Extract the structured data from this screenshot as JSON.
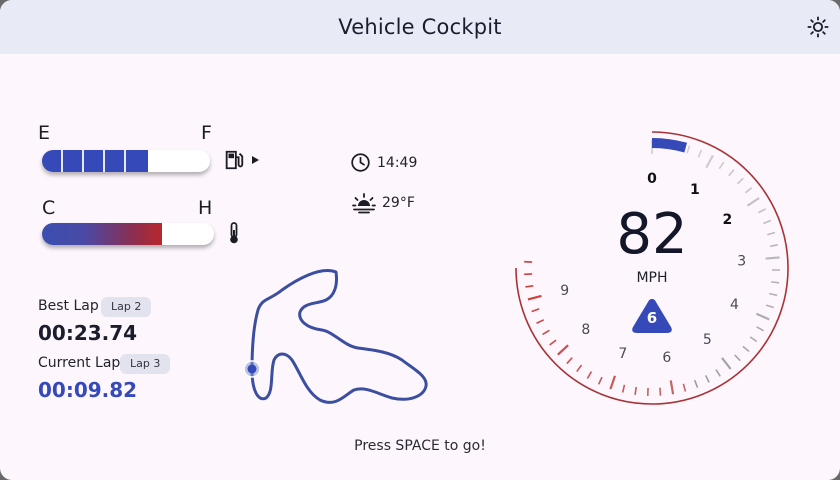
{
  "app": {
    "title": "Vehicle Cockpit",
    "theme_icon": "sun-icon"
  },
  "fuel": {
    "empty_label": "E",
    "full_label": "F",
    "level": 0.63,
    "segments_filled": 5,
    "icon": "fuel-pump-icon",
    "indicator_icon": "play-arrow-icon"
  },
  "temperature": {
    "cold_label": "C",
    "hot_label": "H",
    "level": 0.7,
    "icon": "thermometer-icon"
  },
  "clock": {
    "icon": "clock-icon",
    "time": "14:49"
  },
  "weather": {
    "icon": "sunset-icon",
    "temperature": "29°F"
  },
  "laps": {
    "best": {
      "label": "Best Lap",
      "chip": "Lap 2",
      "time": "00:23.74"
    },
    "current": {
      "label": "Current Lap",
      "chip": "Lap 3",
      "time": "00:09.82"
    }
  },
  "track_map": {
    "position_marker": "car-position-marker"
  },
  "hint": "Press SPACE to go!",
  "speedometer": {
    "speed": "82",
    "unit": "MPH",
    "rpm_labels": [
      "0",
      "1",
      "2",
      "3",
      "4",
      "5",
      "6",
      "7",
      "8",
      "9"
    ],
    "rpm_value": 0.55,
    "rpm_max": 9.5,
    "gear": "6"
  },
  "colors": {
    "accent": "#3549b8",
    "danger": "#b8272a",
    "lap_current": "#3549b8"
  }
}
